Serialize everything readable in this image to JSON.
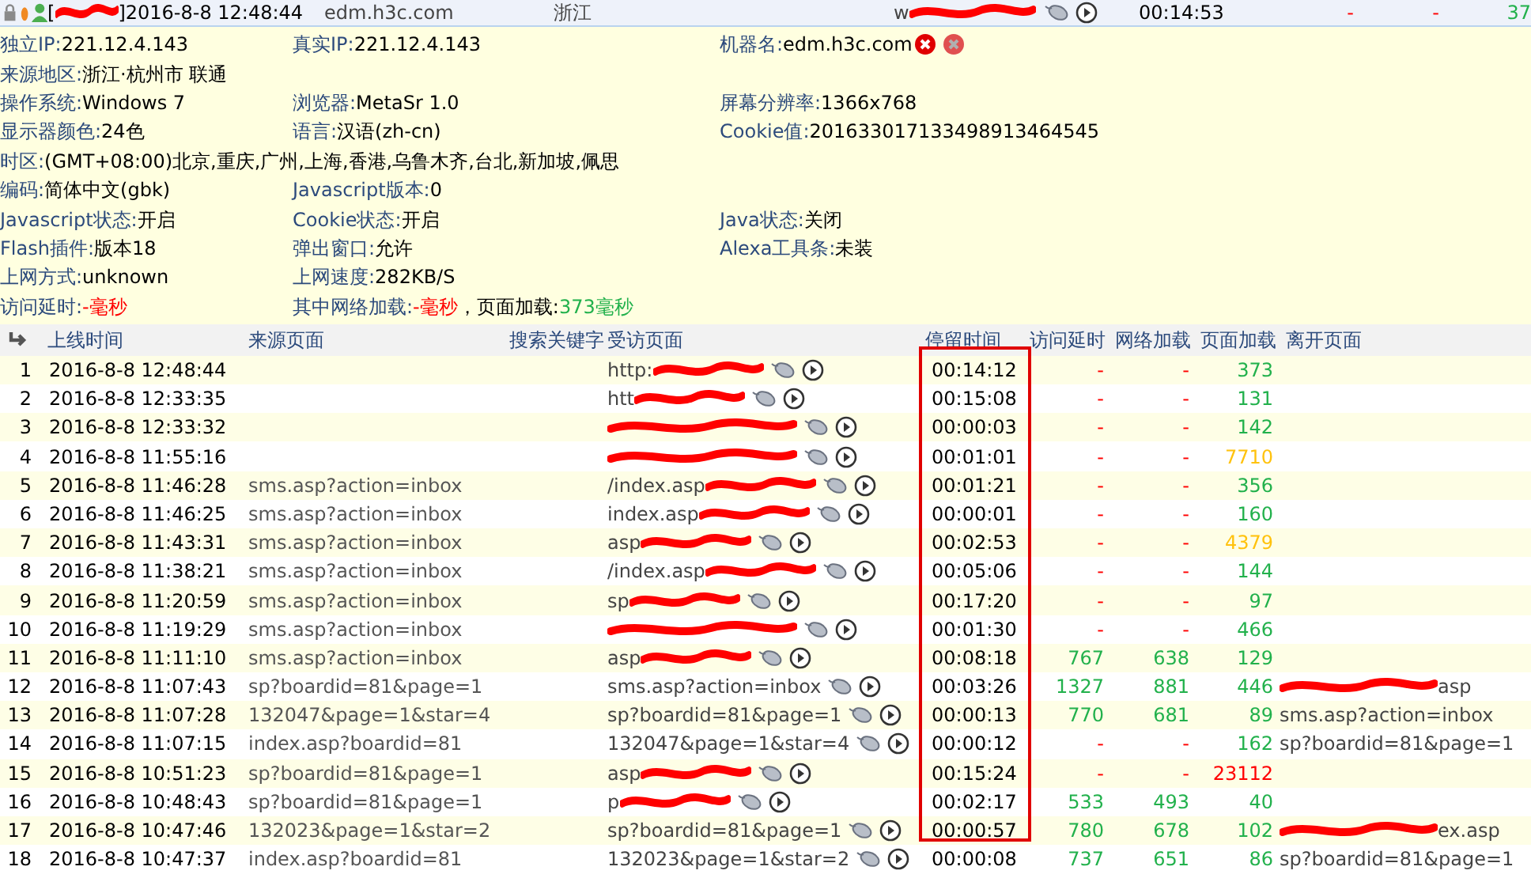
{
  "summary": {
    "user_prefix": "[",
    "user_redacted": true,
    "user_suffix": "]2016-8-8 12:48:44",
    "host": "edm.h3c.com",
    "region": "浙江",
    "page": "w",
    "page_redacted": true,
    "stay": "00:14:53",
    "delay": {
      "text": "-",
      "color": "#ff0000"
    },
    "net": {
      "text": "-",
      "color": "#ff0000"
    },
    "load": {
      "text": "37",
      "color": "#22b14c"
    }
  },
  "info_rows": [
    [
      {
        "label": "独立IP:",
        "value": "221.12.4.143"
      },
      {
        "label": "真实IP:",
        "value": "221.12.4.143"
      },
      {
        "label": "机器名:",
        "value": "edm.h3c.com",
        "kind": "host"
      }
    ],
    [
      {
        "label": "来源地区:",
        "value": "浙江·杭州市 联通"
      }
    ],
    [
      {
        "label": "操作系统:",
        "value": "Windows 7"
      },
      {
        "label": "浏览器:",
        "value": "MetaSr 1.0"
      },
      {
        "label": "屏幕分辨率:",
        "value": "1366x768"
      }
    ],
    [
      {
        "label": "显示器颜色:",
        "value": "24色"
      },
      {
        "label": "语言:",
        "value": "汉语(zh-cn)"
      },
      {
        "label": "Cookie值:",
        "value": "201633017133498913464545"
      }
    ],
    [
      {
        "label": "时区:",
        "value": "(GMT+08:00)北京,重庆,广州,上海,香港,乌鲁木齐,台北,新加坡,佩思"
      }
    ],
    [
      {
        "label": "编码:",
        "value": "简体中文(gbk)"
      },
      {
        "label": "Javascript版本:",
        "value": "0"
      }
    ],
    [
      {
        "label": "Javascript状态:",
        "value": " 开启"
      },
      {
        "label": "Cookie状态:",
        "value": " 开启"
      },
      {
        "label": "Java状态:",
        "value": " 关闭"
      }
    ],
    [
      {
        "label": "Flash插件:",
        "value": "版本18"
      },
      {
        "label": "弹出窗口:",
        "value": " 允许"
      },
      {
        "label": "Alexa工具条:",
        "value": " 未装"
      }
    ],
    [
      {
        "label": "上网方式:",
        "value": "unknown"
      },
      {
        "label": "上网速度:",
        "value": "282KB/S"
      }
    ],
    [
      {
        "label": "访问延时:",
        "parts": [
          {
            "text": "-毫秒",
            "color": "#ff0000"
          }
        ]
      },
      {
        "label": "其中网络加载:",
        "parts": [
          {
            "text": "-毫秒",
            "color": "#ff0000"
          },
          {
            "text": "，页面加载:",
            "color": "#000000"
          },
          {
            "text": "373毫秒",
            "color": "#22b14c"
          }
        ]
      }
    ]
  ],
  "columns": [
    "上线时间",
    "来源页面",
    "搜索关键字",
    "受访页面",
    "停留时间",
    "访问延时",
    "网络加载",
    "页面加载",
    "离开页面"
  ],
  "rows": [
    {
      "no": "1",
      "time": "2016-8-8 12:48:44",
      "visited": "http:",
      "visited_redacted": true,
      "stay": "00:14:12",
      "delay": {
        "text": "-",
        "color": "#ff0000"
      },
      "net": {
        "text": "-",
        "color": "#ff0000"
      },
      "load": {
        "text": "373",
        "color": "#22b14c"
      }
    },
    {
      "no": "2",
      "time": "2016-8-8 12:33:35",
      "visited": "htt",
      "visited_redacted": true,
      "stay": "00:15:08",
      "delay": {
        "text": "-",
        "color": "#ff0000"
      },
      "net": {
        "text": "-",
        "color": "#ff0000"
      },
      "load": {
        "text": "131",
        "color": "#22b14c"
      }
    },
    {
      "no": "3",
      "time": "2016-8-8 12:33:32",
      "visited_redacted": true,
      "stay": "00:00:03",
      "delay": {
        "text": "-",
        "color": "#ff0000"
      },
      "net": {
        "text": "-",
        "color": "#ff0000"
      },
      "load": {
        "text": "142",
        "color": "#22b14c"
      }
    },
    {
      "no": "4",
      "time": "2016-8-8 11:55:16",
      "visited_redacted": true,
      "stay": "00:01:01",
      "delay": {
        "text": "-",
        "color": "#ff0000"
      },
      "net": {
        "text": "-",
        "color": "#ff0000"
      },
      "load": {
        "text": "7710",
        "color": "#ffc20e"
      }
    },
    {
      "no": "5",
      "time": "2016-8-8 11:46:28",
      "source": "sms.asp?action=inbox",
      "visited": "/index.asp",
      "visited_redacted": true,
      "stay": "00:01:21",
      "delay": {
        "text": "-",
        "color": "#ff0000"
      },
      "net": {
        "text": "-",
        "color": "#ff0000"
      },
      "load": {
        "text": "356",
        "color": "#22b14c"
      }
    },
    {
      "no": "6",
      "time": "2016-8-8 11:46:25",
      "source": "sms.asp?action=inbox",
      "visited": "index.asp",
      "visited_redacted": true,
      "stay": "00:00:01",
      "delay": {
        "text": "-",
        "color": "#ff0000"
      },
      "net": {
        "text": "-",
        "color": "#ff0000"
      },
      "load": {
        "text": "160",
        "color": "#22b14c"
      }
    },
    {
      "no": "7",
      "time": "2016-8-8 11:43:31",
      "source": "sms.asp?action=inbox",
      "visited": "asp",
      "visited_redacted": true,
      "stay": "00:02:53",
      "delay": {
        "text": "-",
        "color": "#ff0000"
      },
      "net": {
        "text": "-",
        "color": "#ff0000"
      },
      "load": {
        "text": "4379",
        "color": "#ffc20e"
      }
    },
    {
      "no": "8",
      "time": "2016-8-8 11:38:21",
      "source": "sms.asp?action=inbox",
      "visited": "/index.asp",
      "visited_redacted": true,
      "stay": "00:05:06",
      "delay": {
        "text": "-",
        "color": "#ff0000"
      },
      "net": {
        "text": "-",
        "color": "#ff0000"
      },
      "load": {
        "text": "144",
        "color": "#22b14c"
      }
    },
    {
      "no": "9",
      "time": "2016-8-8 11:20:59",
      "source": "sms.asp?action=inbox",
      "visited": "sp",
      "visited_redacted": true,
      "stay": "00:17:20",
      "delay": {
        "text": "-",
        "color": "#ff0000"
      },
      "net": {
        "text": "-",
        "color": "#ff0000"
      },
      "load": {
        "text": "97",
        "color": "#22b14c"
      }
    },
    {
      "no": "10",
      "time": "2016-8-8 11:19:29",
      "source": "sms.asp?action=inbox",
      "visited_redacted": true,
      "stay": "00:01:30",
      "delay": {
        "text": "-",
        "color": "#ff0000"
      },
      "net": {
        "text": "-",
        "color": "#ff0000"
      },
      "load": {
        "text": "466",
        "color": "#22b14c"
      }
    },
    {
      "no": "11",
      "time": "2016-8-8 11:11:10",
      "source": "sms.asp?action=inbox",
      "visited": "asp",
      "visited_redacted": true,
      "stay": "00:08:18",
      "delay": {
        "text": "767",
        "color": "#22b14c"
      },
      "net": {
        "text": "638",
        "color": "#22b14c"
      },
      "load": {
        "text": "129",
        "color": "#22b14c"
      }
    },
    {
      "no": "12",
      "time": "2016-8-8 11:07:43",
      "source": "sp?boardid=81&page=1",
      "visited": "sms.asp?action=inbox",
      "stay": "00:03:26",
      "delay": {
        "text": "1327",
        "color": "#22b14c"
      },
      "net": {
        "text": "881",
        "color": "#22b14c"
      },
      "load": {
        "text": "446",
        "color": "#22b14c"
      },
      "leave": "asp",
      "leave_redacted": true
    },
    {
      "no": "13",
      "time": "2016-8-8 11:07:28",
      "source": "132047&page=1&star=4",
      "visited": "sp?boardid=81&page=1",
      "stay": "00:00:13",
      "delay": {
        "text": "770",
        "color": "#22b14c"
      },
      "net": {
        "text": "681",
        "color": "#22b14c"
      },
      "load": {
        "text": "89",
        "color": "#22b14c"
      },
      "leave": "sms.asp?action=inbox"
    },
    {
      "no": "14",
      "time": "2016-8-8 11:07:15",
      "source": "index.asp?boardid=81",
      "visited": "132047&page=1&star=4",
      "stay": "00:00:12",
      "delay": {
        "text": "-",
        "color": "#ff0000"
      },
      "net": {
        "text": "-",
        "color": "#ff0000"
      },
      "load": {
        "text": "162",
        "color": "#22b14c"
      },
      "leave": "sp?boardid=81&page=1"
    },
    {
      "no": "15",
      "time": "2016-8-8 10:51:23",
      "source": "sp?boardid=81&page=1",
      "visited": "asp",
      "visited_redacted": true,
      "stay": "00:15:24",
      "delay": {
        "text": "-",
        "color": "#ff0000"
      },
      "net": {
        "text": "-",
        "color": "#ff0000"
      },
      "load": {
        "text": "23112",
        "color": "#ff0000"
      }
    },
    {
      "no": "16",
      "time": "2016-8-8 10:48:43",
      "source": "sp?boardid=81&page=1",
      "visited": "p",
      "visited_redacted": true,
      "stay": "00:02:17",
      "delay": {
        "text": "533",
        "color": "#22b14c"
      },
      "net": {
        "text": "493",
        "color": "#22b14c"
      },
      "load": {
        "text": "40",
        "color": "#22b14c"
      }
    },
    {
      "no": "17",
      "time": "2016-8-8 10:47:46",
      "source": "132023&page=1&star=2",
      "visited": "sp?boardid=81&page=1",
      "stay": "00:00:57",
      "delay": {
        "text": "780",
        "color": "#22b14c"
      },
      "net": {
        "text": "678",
        "color": "#22b14c"
      },
      "load": {
        "text": "102",
        "color": "#22b14c"
      },
      "leave": "ex.asp",
      "leave_redacted": true
    },
    {
      "no": "18",
      "time": "2016-8-8 10:47:37",
      "source": "index.asp?boardid=81",
      "visited": "132023&page=1&star=2",
      "stay": "00:00:08",
      "delay": {
        "text": "737",
        "color": "#22b14c"
      },
      "net": {
        "text": "651",
        "color": "#22b14c"
      },
      "load": {
        "text": "86",
        "color": "#22b14c"
      },
      "leave": "sp?boardid=81&page=1"
    }
  ]
}
